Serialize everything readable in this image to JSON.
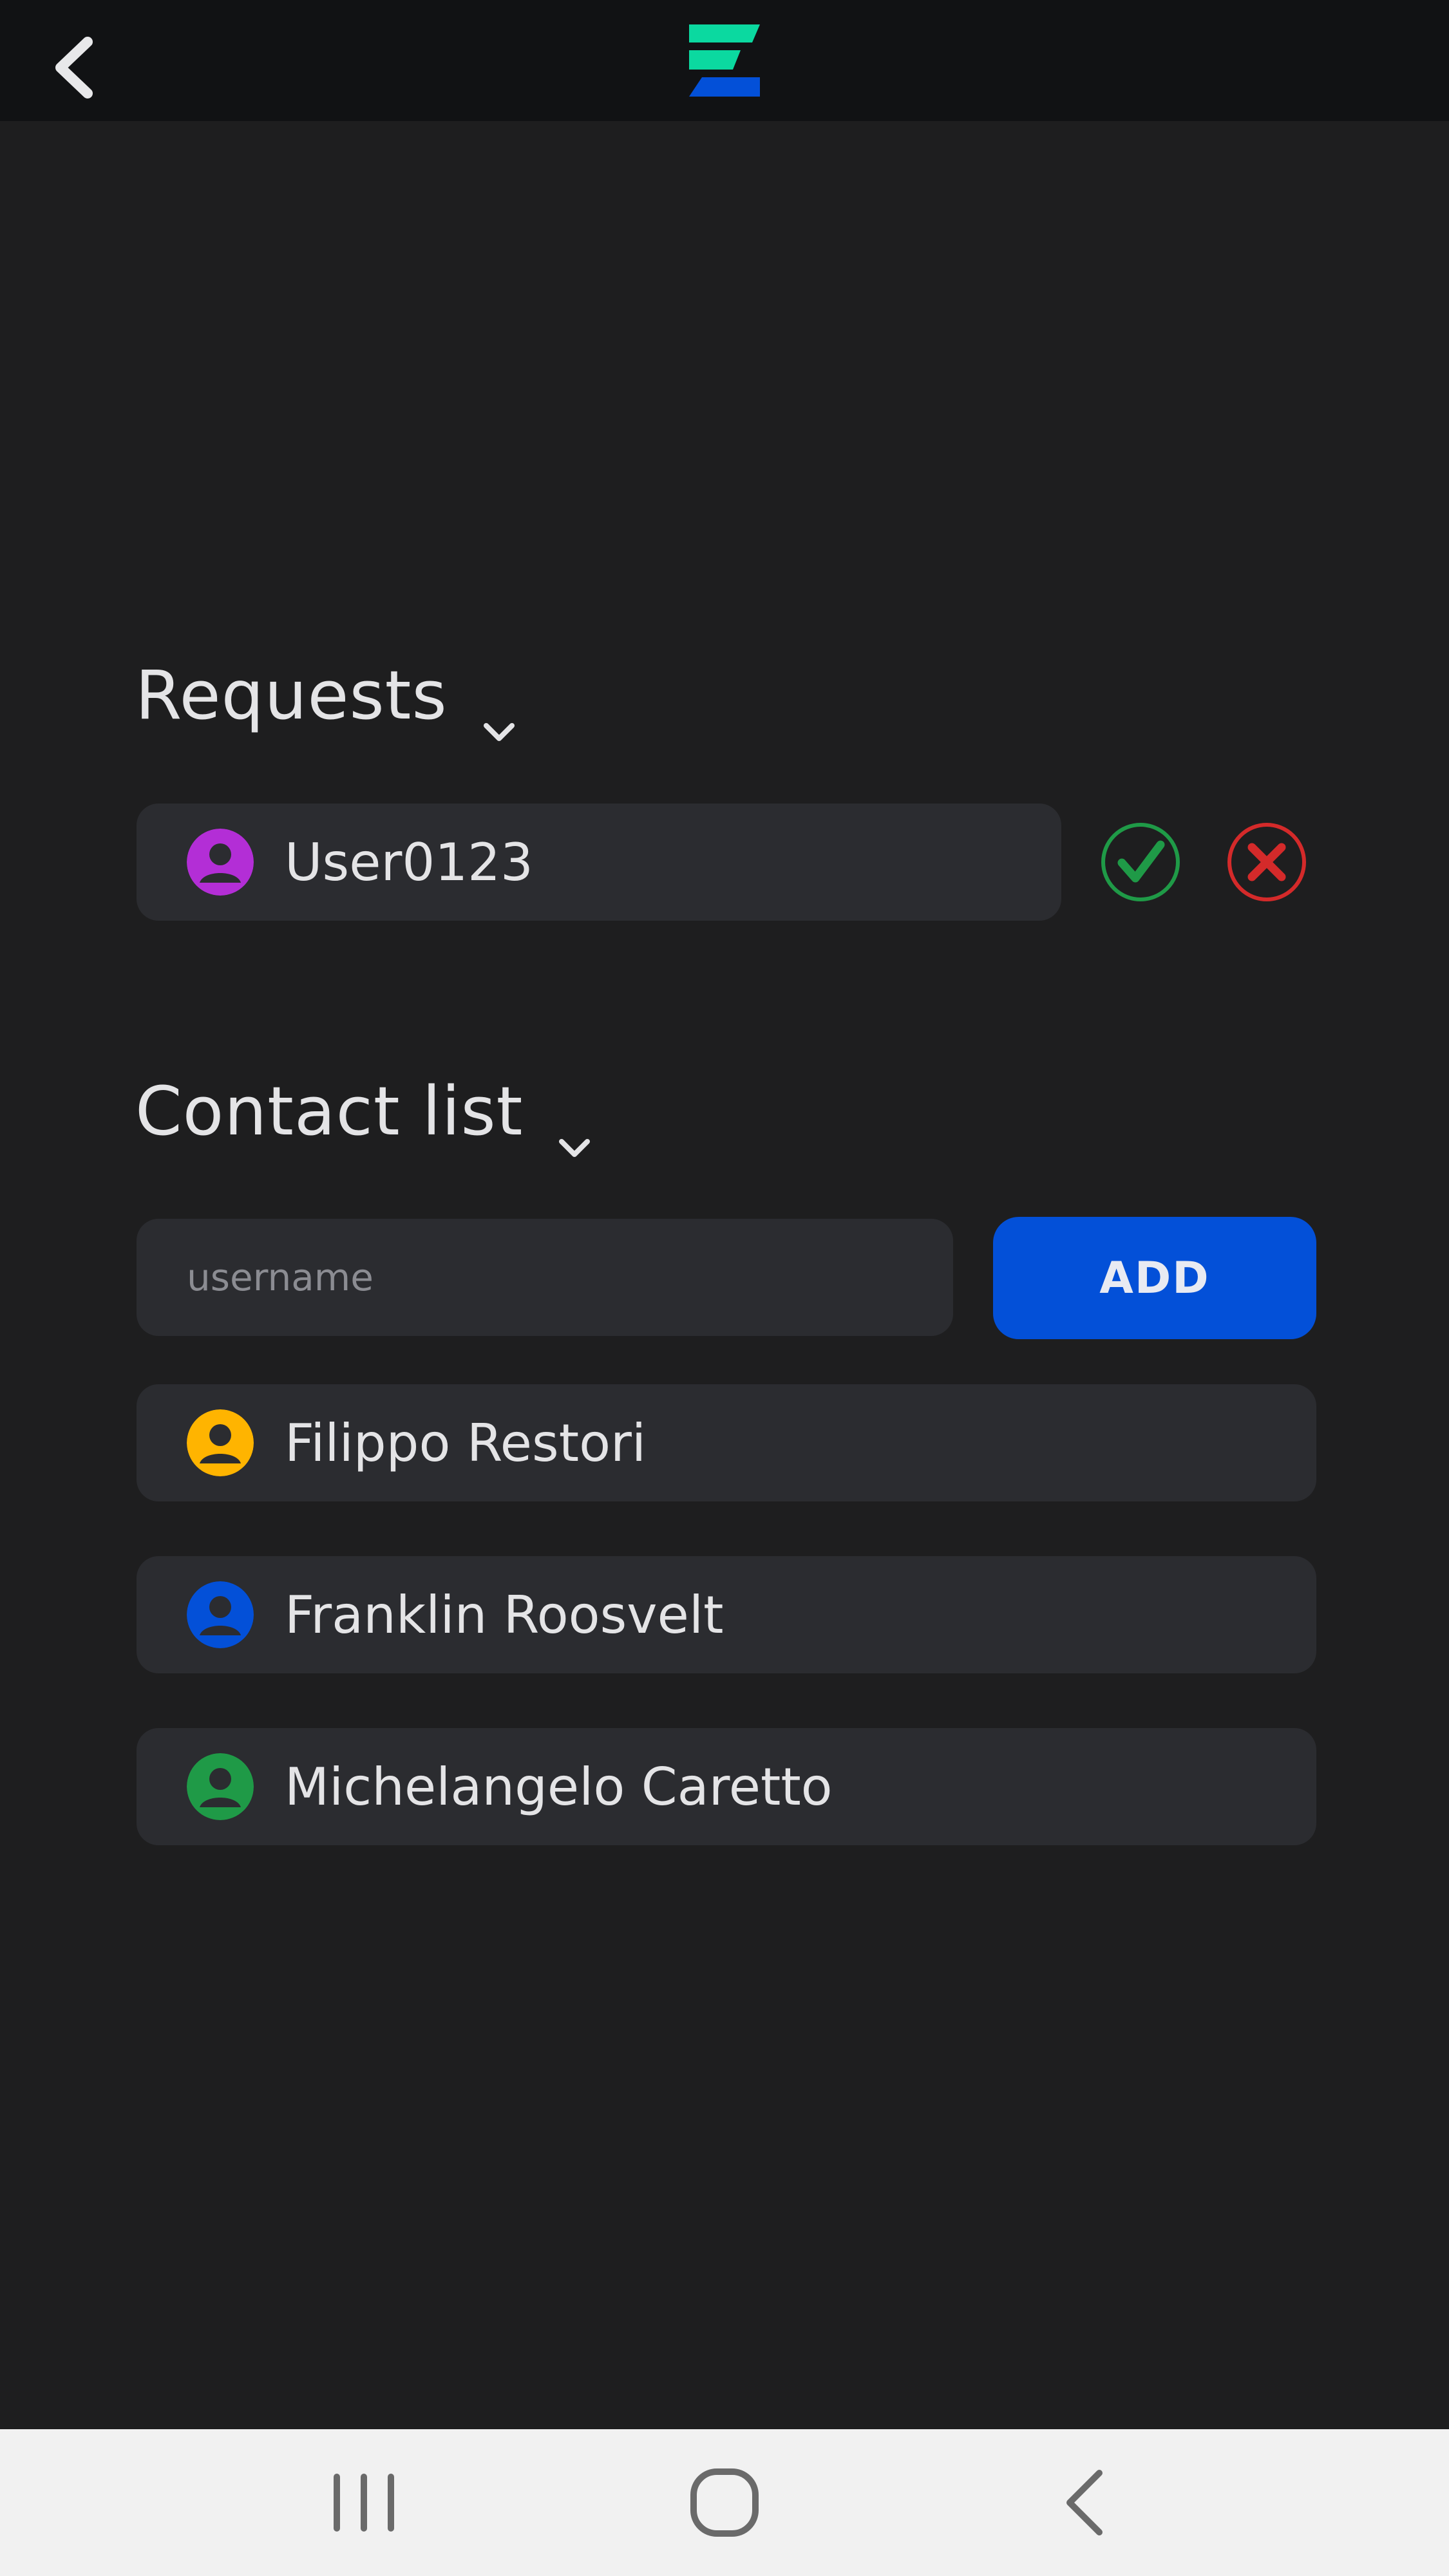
{
  "colors": {
    "background": "#1e1e1f",
    "appbar": "#111214",
    "card": "#2b2c30",
    "primary_button": "#0350d8",
    "accept": "#1f9a47",
    "reject": "#d42a2a",
    "logo_top": "#0bd9a0",
    "logo_bottom": "#0350d8"
  },
  "appbar": {
    "back_icon": "chevron-left-icon",
    "logo_icon": "app-logo"
  },
  "requests": {
    "title": "Requests",
    "items": [
      {
        "username": "User0123",
        "avatar_color": "#b32ed6"
      }
    ],
    "accept_icon": "check-circle-icon",
    "reject_icon": "x-circle-icon"
  },
  "contacts": {
    "title": "Contact list",
    "input_placeholder": "username",
    "input_value": "",
    "add_label": "ADD",
    "items": [
      {
        "name": "Filippo Restori",
        "avatar_color": "#ffb400"
      },
      {
        "name": "Franklin Roosvelt",
        "avatar_color": "#0350d8"
      },
      {
        "name": "Michelangelo Caretto",
        "avatar_color": "#1f9a47"
      }
    ]
  },
  "navbar": {
    "recents_icon": "recents-icon",
    "home_icon": "home-icon",
    "back_icon": "back-icon"
  }
}
